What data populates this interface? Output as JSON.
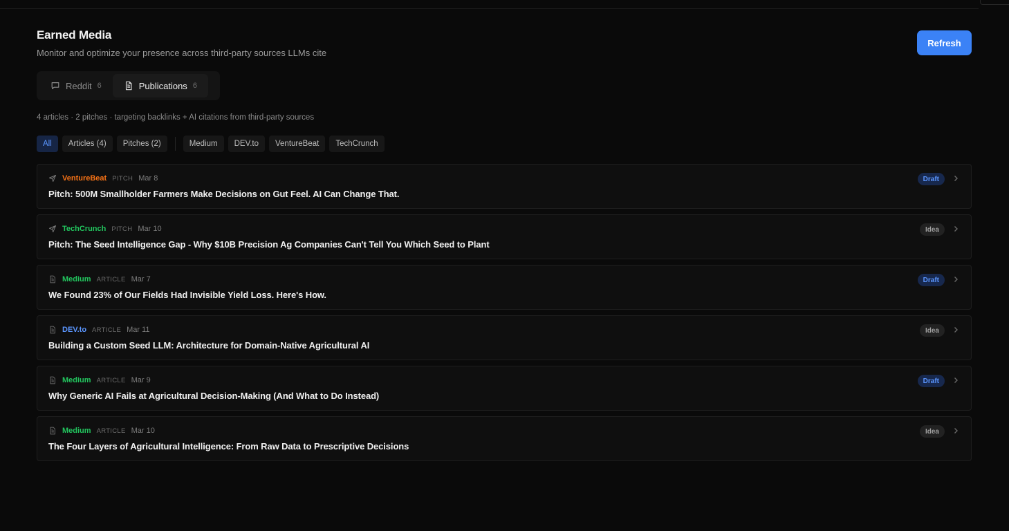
{
  "header": {
    "title": "Earned Media",
    "subtitle": "Monitor and optimize your presence across third-party sources LLMs cite",
    "refresh_label": "Refresh"
  },
  "tabs": [
    {
      "label": "Reddit",
      "count": "6",
      "icon": "chat-bubble-icon",
      "active": false
    },
    {
      "label": "Publications",
      "count": "6",
      "icon": "document-icon",
      "active": true
    }
  ],
  "summary": "4 articles · 2 pitches · targeting backlinks + AI citations from third-party sources",
  "filters": {
    "type": [
      "All",
      "Articles (4)",
      "Pitches (2)"
    ],
    "sources": [
      "Medium",
      "DEV.to",
      "VentureBeat",
      "TechCrunch"
    ],
    "active": "All"
  },
  "colors": {
    "accent": "#3b82f6",
    "venturebeat": "#f97316",
    "techcrunch": "#22c55e",
    "medium": "#22c55e",
    "devto": "#5b96ff"
  },
  "items": [
    {
      "source": "VentureBeat",
      "source_color": "#f97316",
      "kind": "PITCH",
      "date": "Mar 8",
      "title": "Pitch: 500M Smallholder Farmers Make Decisions on Gut Feel. AI Can Change That.",
      "status": "Draft",
      "icon": "send-icon"
    },
    {
      "source": "TechCrunch",
      "source_color": "#22c55e",
      "kind": "PITCH",
      "date": "Mar 10",
      "title": "Pitch: The Seed Intelligence Gap - Why $10B Precision Ag Companies Can't Tell You Which Seed to Plant",
      "status": "Idea",
      "icon": "send-icon"
    },
    {
      "source": "Medium",
      "source_color": "#22c55e",
      "kind": "ARTICLE",
      "date": "Mar 7",
      "title": "We Found 23% of Our Fields Had Invisible Yield Loss. Here's How.",
      "status": "Draft",
      "icon": "document-icon"
    },
    {
      "source": "DEV.to",
      "source_color": "#5b96ff",
      "kind": "ARTICLE",
      "date": "Mar 11",
      "title": "Building a Custom Seed LLM: Architecture for Domain-Native Agricultural AI",
      "status": "Idea",
      "icon": "document-icon"
    },
    {
      "source": "Medium",
      "source_color": "#22c55e",
      "kind": "ARTICLE",
      "date": "Mar 9",
      "title": "Why Generic AI Fails at Agricultural Decision-Making (And What to Do Instead)",
      "status": "Draft",
      "icon": "document-icon"
    },
    {
      "source": "Medium",
      "source_color": "#22c55e",
      "kind": "ARTICLE",
      "date": "Mar 10",
      "title": "The Four Layers of Agricultural Intelligence: From Raw Data to Prescriptive Decisions",
      "status": "Idea",
      "icon": "document-icon"
    }
  ]
}
